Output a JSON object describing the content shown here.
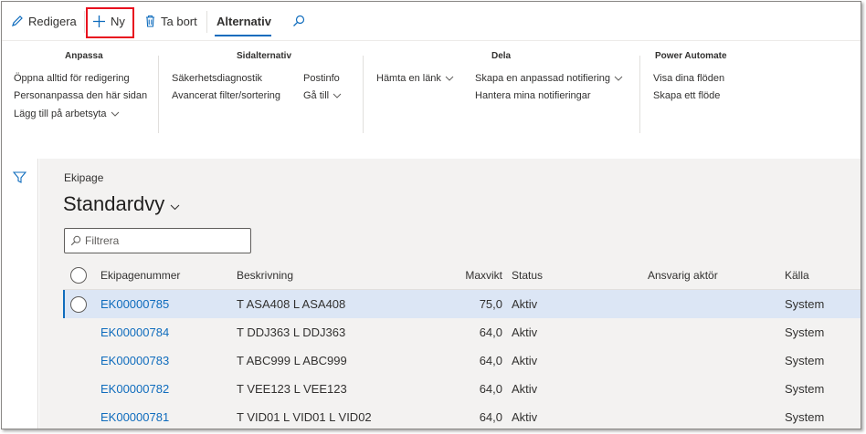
{
  "toolbar": {
    "edit_label": "Redigera",
    "new_label": "Ny",
    "delete_label": "Ta bort",
    "options_tab_label": "Alternativ"
  },
  "ribbon": {
    "customize": {
      "title": "Anpassa",
      "items": [
        "Öppna alltid för redigering",
        "Personanpassa den här sidan",
        "Lägg till på arbetsyta"
      ]
    },
    "page_options": {
      "title": "Sidalternativ",
      "items": [
        "Säkerhetsdiagnostik",
        "Avancerat filter/sortering",
        "Postinfo",
        "Gå till"
      ]
    },
    "share": {
      "title": "Dela",
      "items": [
        "Hämta en länk",
        "Skapa en anpassad notifiering",
        "Hantera mina notifieringar"
      ]
    },
    "power_automate": {
      "title": "Power Automate",
      "items": [
        "Visa dina flöden",
        "Skapa ett flöde"
      ]
    }
  },
  "page": {
    "breadcrumb": "Ekipage",
    "view_title": "Standardvy",
    "filter_placeholder": "Filtrera"
  },
  "grid": {
    "columns": [
      "Ekipagenummer",
      "Beskrivning",
      "Maxvikt",
      "Status",
      "Ansvarig aktör",
      "Källa"
    ],
    "rows": [
      {
        "number": "EK00000785",
        "description": "T ASA408 L ASA408",
        "max": "75,0",
        "status": "Aktiv",
        "responsible": "",
        "source": "System"
      },
      {
        "number": "EK00000784",
        "description": "T DDJ363 L DDJ363",
        "max": "64,0",
        "status": "Aktiv",
        "responsible": "",
        "source": "System"
      },
      {
        "number": "EK00000783",
        "description": "T ABC999 L ABC999",
        "max": "64,0",
        "status": "Aktiv",
        "responsible": "",
        "source": "System"
      },
      {
        "number": "EK00000782",
        "description": "T VEE123 L VEE123",
        "max": "64,0",
        "status": "Aktiv",
        "responsible": "",
        "source": "System"
      },
      {
        "number": "EK00000781",
        "description": "T VID01 L VID01 L VID02",
        "max": "64,0",
        "status": "Aktiv",
        "responsible": "",
        "source": "System"
      }
    ]
  },
  "colors": {
    "accent": "#0f6cbd",
    "highlight": "#e8101e",
    "selected_row": "#dce6f5"
  },
  "icons": [
    "pencil-icon",
    "plus-icon",
    "trash-icon",
    "search-icon",
    "filter-icon",
    "chevron-down-icon"
  ]
}
